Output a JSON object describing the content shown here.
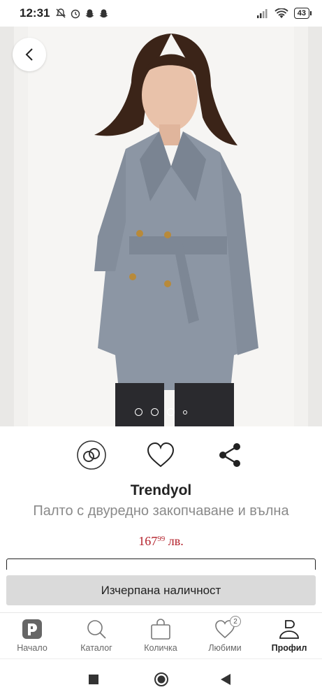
{
  "status_bar": {
    "time": "12:31",
    "left_icons": [
      "notifications-muted-icon",
      "alarm-icon",
      "snapchat-icon",
      "snapchat-icon"
    ],
    "right_icons": [
      "signal-icon",
      "wifi-icon"
    ],
    "battery": "43"
  },
  "gallery": {
    "image_count": 4,
    "active_index": 0,
    "back_icon": "chevron-left-icon"
  },
  "actions": [
    {
      "icon": "compare-rings-icon"
    },
    {
      "icon": "heart-icon"
    },
    {
      "icon": "share-icon"
    }
  ],
  "product": {
    "brand": "Trendyol",
    "name": "Палто с двуредно закопчаване и вълна",
    "price_main": "167",
    "price_cents": "99",
    "currency": "лв.",
    "out_of_stock_label": "Изчерпана наличност"
  },
  "bottom_nav": {
    "items": [
      {
        "label": "Начало",
        "icon": "home-logo-icon"
      },
      {
        "label": "Каталог",
        "icon": "search-icon"
      },
      {
        "label": "Количка",
        "icon": "cart-bag-icon"
      },
      {
        "label": "Любими",
        "icon": "heart-icon",
        "badge": "2"
      },
      {
        "label": "Профил",
        "icon": "profile-icon",
        "active": true
      }
    ]
  },
  "colors": {
    "price": "#b3202a",
    "button_bg": "#dadada"
  }
}
